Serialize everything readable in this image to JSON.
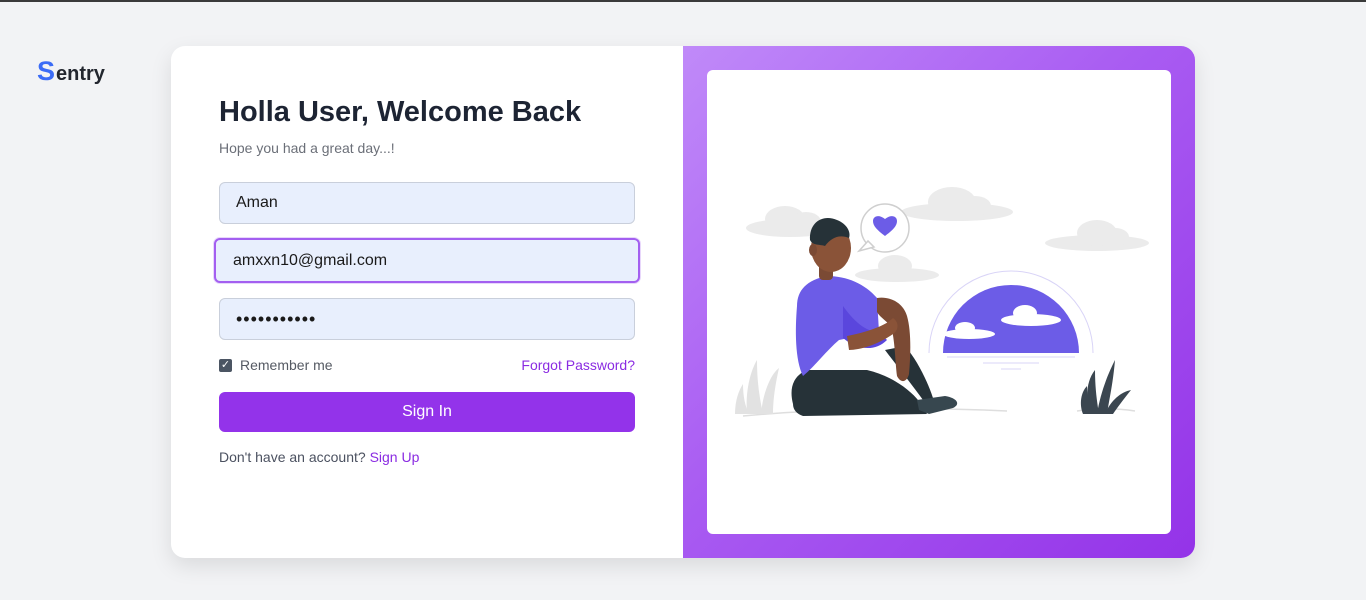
{
  "brand": {
    "logo_initial": "S",
    "logo_rest": "entry"
  },
  "login": {
    "title": "Holla User, Welcome Back",
    "subtitle": "Hope you had a great day...!",
    "fields": {
      "name_value": "Aman",
      "email_value": "amxxn10@gmail.com",
      "password_masked": "•••••••••••"
    },
    "remember_label": "Remember me",
    "remember_checked": true,
    "forgot_label": "Forgot Password?",
    "signin_label": "Sign In",
    "signup_prompt": "Don't have an account?",
    "signup_label": "Sign Up"
  },
  "colors": {
    "accent": "#9333ea",
    "link": "#8a2be2",
    "logo_blue": "#3b6cf6",
    "illustration_purple": "#6c5ce7"
  },
  "icons": [
    "checkbox-check-icon",
    "heart-icon"
  ]
}
